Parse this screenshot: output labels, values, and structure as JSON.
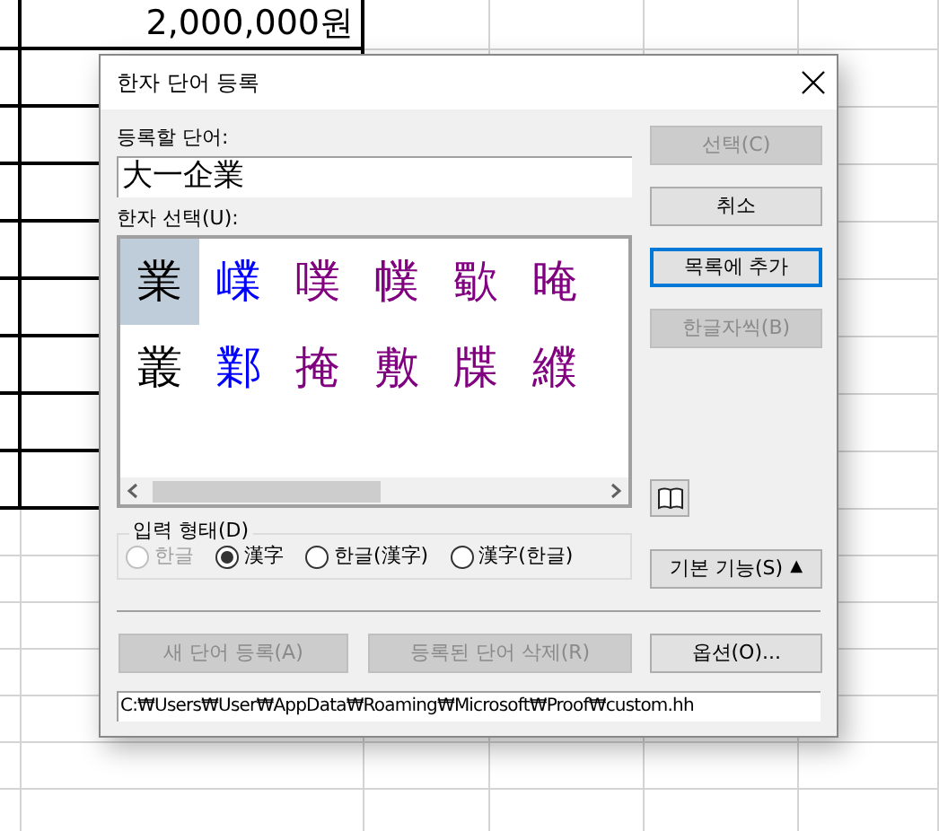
{
  "sheet": {
    "cells": [
      {
        "text": "2,000,000원"
      }
    ]
  },
  "dialog": {
    "title": "한자 단어 등록",
    "word_label": "등록할 단어:",
    "word_value": "大一企業",
    "hanja_label": "한자 선택(U):",
    "hanja_rows": [
      [
        {
          "char": "業",
          "color": "#000000",
          "selected": true
        },
        {
          "char": "嶫",
          "color": "#0000ff",
          "selected": false
        },
        {
          "char": "噗",
          "color": "#800080",
          "selected": false
        },
        {
          "char": "幞",
          "color": "#800080",
          "selected": false
        },
        {
          "char": "歜",
          "color": "#800080",
          "selected": false
        },
        {
          "char": "晻",
          "color": "#800080",
          "selected": false
        }
      ],
      [
        {
          "char": "叢",
          "color": "#000000",
          "selected": false
        },
        {
          "char": "鄴",
          "color": "#0000ff",
          "selected": false
        },
        {
          "char": "掩",
          "color": "#800080",
          "selected": false
        },
        {
          "char": "敷",
          "color": "#800080",
          "selected": false
        },
        {
          "char": "牒",
          "color": "#800080",
          "selected": false
        },
        {
          "char": "纀",
          "color": "#800080",
          "selected": false
        }
      ]
    ],
    "input_form": {
      "label": "입력 형태(D)",
      "options": [
        {
          "label": "한글",
          "selected": false,
          "disabled": true
        },
        {
          "label": "漢字",
          "selected": true,
          "disabled": false
        },
        {
          "label": "한글(漢字)",
          "selected": false,
          "disabled": false
        },
        {
          "label": "漢字(한글)",
          "selected": false,
          "disabled": false
        }
      ]
    },
    "side_buttons": [
      {
        "label": "선택(C)",
        "disabled": true,
        "focused": false
      },
      {
        "label": "취소",
        "disabled": false,
        "focused": false
      },
      {
        "label": "목록에 추가",
        "disabled": false,
        "focused": true
      },
      {
        "label": "한글자씩(B)",
        "disabled": true,
        "focused": false
      }
    ],
    "basic_button": {
      "label": "기본 기능(S)",
      "arrow": "▲"
    },
    "bottom_buttons": [
      {
        "label": "새 단어 등록(A)",
        "disabled": true
      },
      {
        "label": "등록된 단어 삭제(R)",
        "disabled": true
      },
      {
        "label": "옵션(O)...",
        "disabled": false
      }
    ],
    "path": "C:₩Users₩User₩AppData₩Roaming₩Microsoft₩Proof₩custom.hh"
  }
}
